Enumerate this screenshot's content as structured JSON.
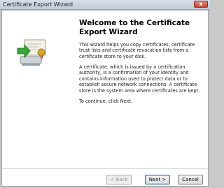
{
  "window": {
    "title": "Certificate Export Wizard",
    "close_glyph": "x"
  },
  "main": {
    "heading": "Welcome to the Certificate Export Wizard",
    "paragraphs": [
      "This wizard helps you copy certificates, certificate trust lists and certificate revocation lists from a certificate store to your disk.",
      "A certificate, which is issued by a certification authority, is a confirmation of your identity and contains information used to protect data or to establish secure network connections. A certificate store is the system area where certificates are kept.",
      "To continue, click Next."
    ]
  },
  "buttons": {
    "back": "< Back",
    "next": "Next >",
    "cancel": "Cancel"
  },
  "icons": {
    "wizard_art": "certificate-export-icon"
  },
  "colors": {
    "arrow_green": "#3aa43a",
    "seal_gold": "#d6a52a"
  }
}
